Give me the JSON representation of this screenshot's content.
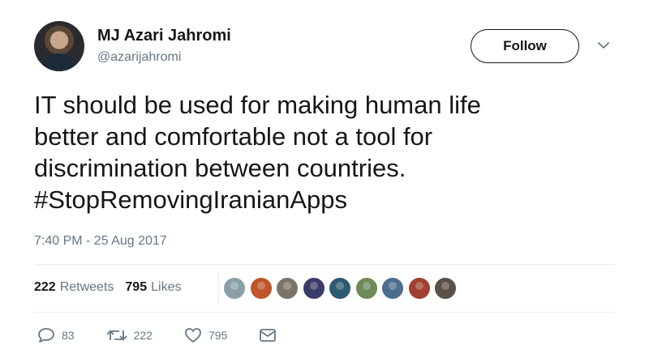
{
  "author": {
    "name": "MJ Azari Jahromi",
    "handle": "@azarijahromi"
  },
  "follow_label": "Follow",
  "tweet": {
    "lines": [
      "IT should be used for making human life",
      "better and comfortable not a tool for",
      "discrimination between countries.",
      "#StopRemovingIranianApps"
    ]
  },
  "timestamp": "7:40 PM - 25 Aug 2017",
  "stats": {
    "retweets_count": "222",
    "retweets_label": "Retweets",
    "likes_count": "795",
    "likes_label": "Likes"
  },
  "liker_avatar_colors": [
    "#8aa0a8",
    "#c0542a",
    "#7c7468",
    "#3b3b6a",
    "#2f5a74",
    "#6d8a5a",
    "#4a6e8c",
    "#a04030",
    "#5a5048"
  ],
  "actions": {
    "replies": "83",
    "retweets": "222",
    "likes": "795"
  },
  "colors": {
    "text": "#14171a",
    "secondary": "#657786",
    "divider": "#e6ecf0"
  }
}
